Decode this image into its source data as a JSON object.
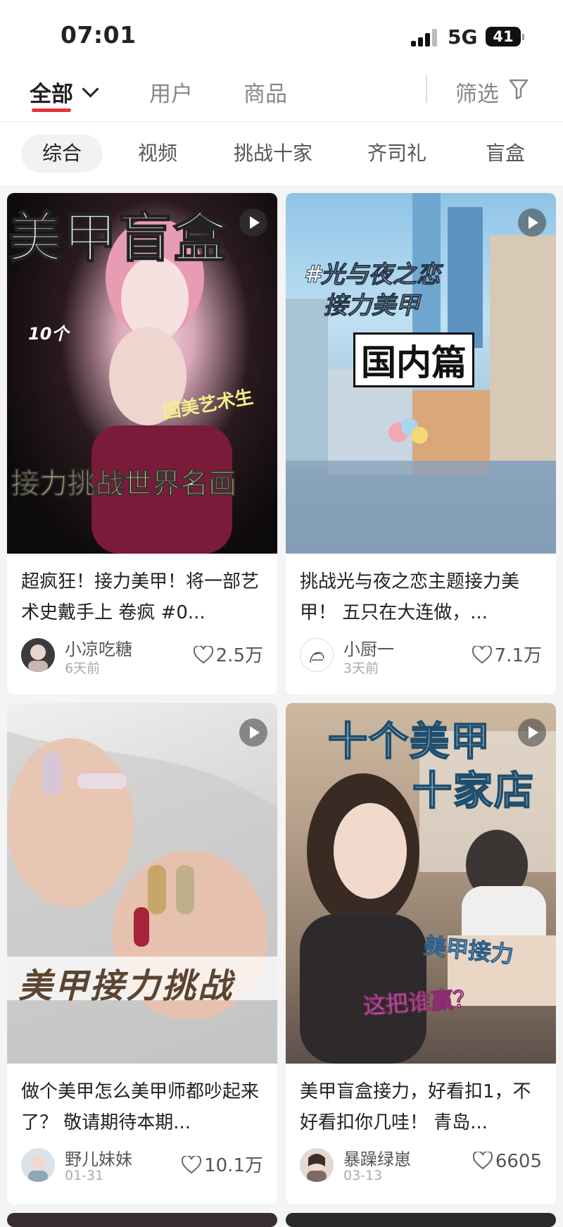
{
  "status_bar": {
    "time": "07:01",
    "network": "5G",
    "battery": "41"
  },
  "top_tabs": {
    "all": "全部",
    "users": "用户",
    "products": "商品",
    "filter": "筛选"
  },
  "chips": [
    "综合",
    "视频",
    "挑战十家",
    "齐司礼",
    "盲盒"
  ],
  "cards": [
    {
      "overlay": [
        "美甲盲盒",
        "10个",
        "国美艺术生",
        "接力挑战世界名画"
      ],
      "title": "超疯狂！接力美甲！将一部艺术史戴手上 卷疯 #0...",
      "author": "小凉吃糖",
      "date": "6天前",
      "likes": "2.5万"
    },
    {
      "overlay": [
        "#光与夜之恋",
        "接力美甲",
        "国内篇"
      ],
      "title": "挑战光与夜之恋主题接力美甲！ 五只在大连做，...",
      "author": "小厨一",
      "date": "3天前",
      "likes": "7.1万"
    },
    {
      "overlay": [
        "美甲接力挑战"
      ],
      "title": "做个美甲怎么美甲师都吵起来了？ 敬请期待本期...",
      "author": "野儿妹妹",
      "date": "01-31",
      "likes": "10.1万"
    },
    {
      "overlay": [
        "十个美甲",
        "十家店",
        "美甲接力",
        "这把谁赢？"
      ],
      "title": "美甲盲盒接力，好看扣1，不好看扣你几哇！ 青岛...",
      "author": "暴躁绿崽",
      "date": "03-13",
      "likes": "6605"
    }
  ],
  "colors": {
    "accent": "#e7303b"
  }
}
